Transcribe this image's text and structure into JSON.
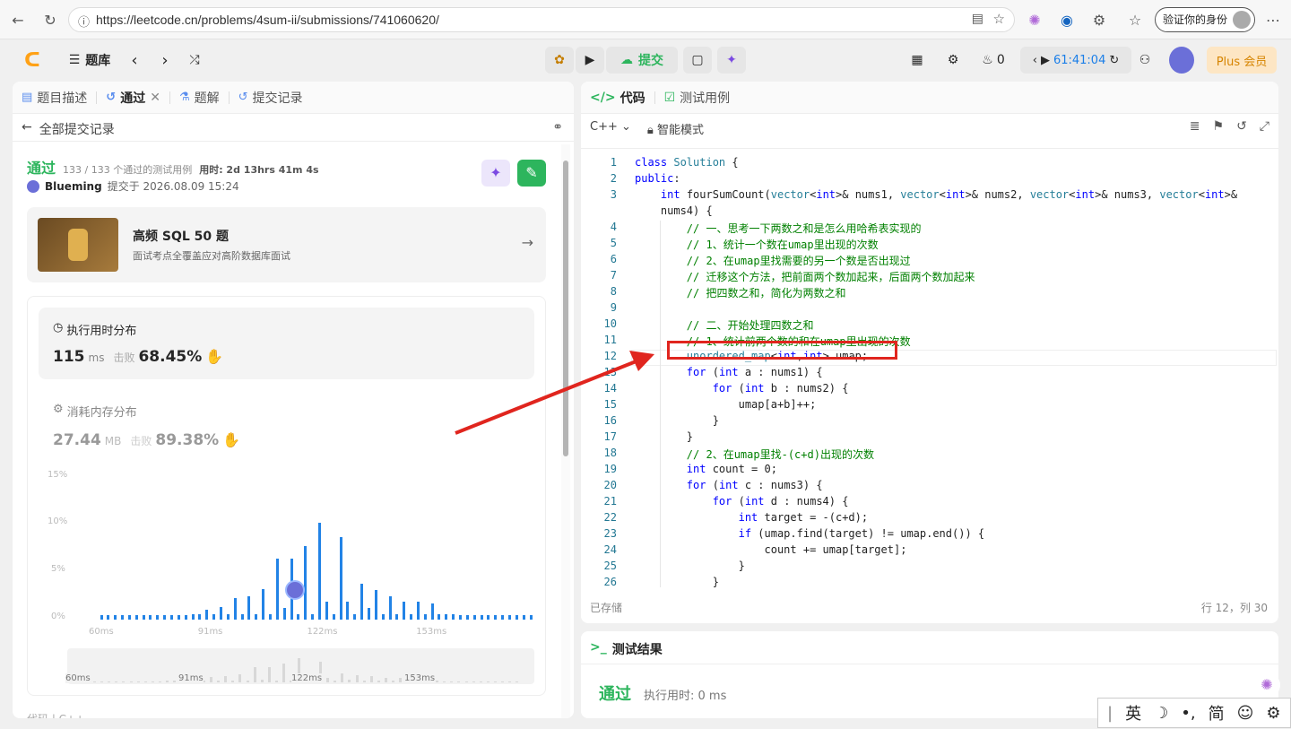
{
  "browser": {
    "url": "https://leetcode.cn/problems/4sum-ii/submissions/741060620/",
    "verify_label": "验证你的身份"
  },
  "header": {
    "problem_bank": "题库",
    "submit": "提交",
    "streak": "0",
    "timer": "61:41:04",
    "plus": "Plus 会员"
  },
  "left": {
    "tabs": [
      "题目描述",
      "通过",
      "题解",
      "提交记录"
    ],
    "back_label": "全部提交记录",
    "status": "通过",
    "cases": "133 / 133 个通过的测试用例",
    "used_time": "用时: 2d 13hrs 41m 4s",
    "user": "Blueming",
    "submitted": "提交于 2026.08.09 15:24",
    "promo_title": "高频 SQL 50 题",
    "promo_sub": "面试考点全覆盖应对高阶数据库面试",
    "runtime_label": "执行用时分布",
    "runtime_value": "115",
    "runtime_unit": "ms",
    "beat_label": "击败",
    "runtime_beat": "68.45%",
    "mem_label": "消耗内存分布",
    "mem_value": "27.44",
    "mem_unit": "MB",
    "mem_beat": "89.38%",
    "bottom_cut": "代码 | C++"
  },
  "chart_data": {
    "type": "bar",
    "title": "",
    "xlabel": "",
    "ylabel": "",
    "y_ticks": [
      "15%",
      "10%",
      "5%",
      "0%"
    ],
    "ylim": [
      0,
      15
    ],
    "x_ticks": [
      "60ms",
      "91ms",
      "122ms",
      "153ms"
    ],
    "x_tick_values": [
      60,
      91,
      122,
      153
    ],
    "xlim": [
      60,
      183
    ],
    "x": [
      60,
      62,
      64,
      66,
      68,
      70,
      72,
      74,
      76,
      78,
      80,
      82,
      84,
      86,
      88,
      90,
      92,
      94,
      96,
      98,
      100,
      102,
      104,
      106,
      108,
      110,
      112,
      114,
      116,
      118,
      120,
      122,
      124,
      126,
      128,
      130,
      132,
      134,
      136,
      138,
      140,
      142,
      144,
      146,
      148,
      150,
      152,
      154,
      156,
      158,
      160,
      162,
      164,
      166,
      168,
      170,
      172,
      174,
      176,
      178,
      180,
      182
    ],
    "values": [
      0.5,
      0.5,
      0.5,
      0.5,
      0.5,
      0.5,
      0.5,
      0.5,
      0.5,
      0.5,
      0.5,
      0.5,
      0.5,
      0.6,
      0.6,
      1.0,
      0.6,
      1.3,
      0.6,
      2.3,
      0.6,
      2.5,
      0.6,
      3.2,
      0.6,
      6.4,
      1.2,
      6.4,
      0.6,
      7.7,
      0.6,
      10.2,
      1.9,
      0.6,
      8.7,
      1.9,
      0.6,
      3.8,
      1.2,
      3.1,
      0.6,
      2.5,
      0.6,
      1.9,
      0.6,
      1.9,
      0.6,
      1.7,
      0.6,
      0.6,
      0.6,
      0.5,
      0.5,
      0.5,
      0.5,
      0.5,
      0.5,
      0.5,
      0.5,
      0.5,
      0.5,
      0.5
    ],
    "highlight_x": 115
  },
  "right": {
    "tabs": [
      "代码",
      "测试用例"
    ],
    "lang": "C++",
    "mode": "智能模式",
    "saved": "已存储",
    "cursor": "行 12，列 30",
    "result_title": "测试结果",
    "result_status": "通过",
    "result_time": "执行用时: 0 ms"
  },
  "code_lines": [
    {
      "n": "1",
      "t": "class Solution {"
    },
    {
      "n": "2",
      "t": "public:"
    },
    {
      "n": "3",
      "t": "    int fourSumCount(vector<int>& nums1, vector<int>& nums2, vector<int>& nums3, vector<int>&"
    },
    {
      "n": "",
      "t": "    nums4) {"
    },
    {
      "n": "4",
      "t": "        // 一、思考一下两数之和是怎么用哈希表实现的"
    },
    {
      "n": "5",
      "t": "        // 1、统计一个数在umap里出现的次数"
    },
    {
      "n": "6",
      "t": "        // 2、在umap里找需要的另一个数是否出现过"
    },
    {
      "n": "7",
      "t": "        // 迁移这个方法，把前面两个数加起来，后面两个数加起来"
    },
    {
      "n": "8",
      "t": "        // 把四数之和，简化为两数之和"
    },
    {
      "n": "9",
      "t": ""
    },
    {
      "n": "10",
      "t": "        // 二、开始处理四数之和"
    },
    {
      "n": "11",
      "t": "        // 1、统计前两个数的和在umap里出现的次数"
    },
    {
      "n": "12",
      "t": "        unordered_map<int,int> umap;"
    },
    {
      "n": "13",
      "t": "        for (int a : nums1) {"
    },
    {
      "n": "14",
      "t": "            for (int b : nums2) {"
    },
    {
      "n": "15",
      "t": "                umap[a+b]++;"
    },
    {
      "n": "16",
      "t": "            }"
    },
    {
      "n": "17",
      "t": "        }"
    },
    {
      "n": "18",
      "t": "        // 2、在umap里找-(c+d)出现的次数"
    },
    {
      "n": "19",
      "t": "        int count = 0;"
    },
    {
      "n": "20",
      "t": "        for (int c : nums3) {"
    },
    {
      "n": "21",
      "t": "            for (int d : nums4) {"
    },
    {
      "n": "22",
      "t": "                int target = -(c+d);"
    },
    {
      "n": "23",
      "t": "                if (umap.find(target) != umap.end()) {"
    },
    {
      "n": "24",
      "t": "                    count += umap[target];"
    },
    {
      "n": "25",
      "t": "                }"
    },
    {
      "n": "26",
      "t": "            }"
    }
  ],
  "ime": {
    "lang": "英",
    "mode": "简"
  },
  "colors": {
    "accent": "#2db55d",
    "brand": "#ffa116",
    "bar": "#2283e6",
    "arrow": "#e0251e"
  }
}
